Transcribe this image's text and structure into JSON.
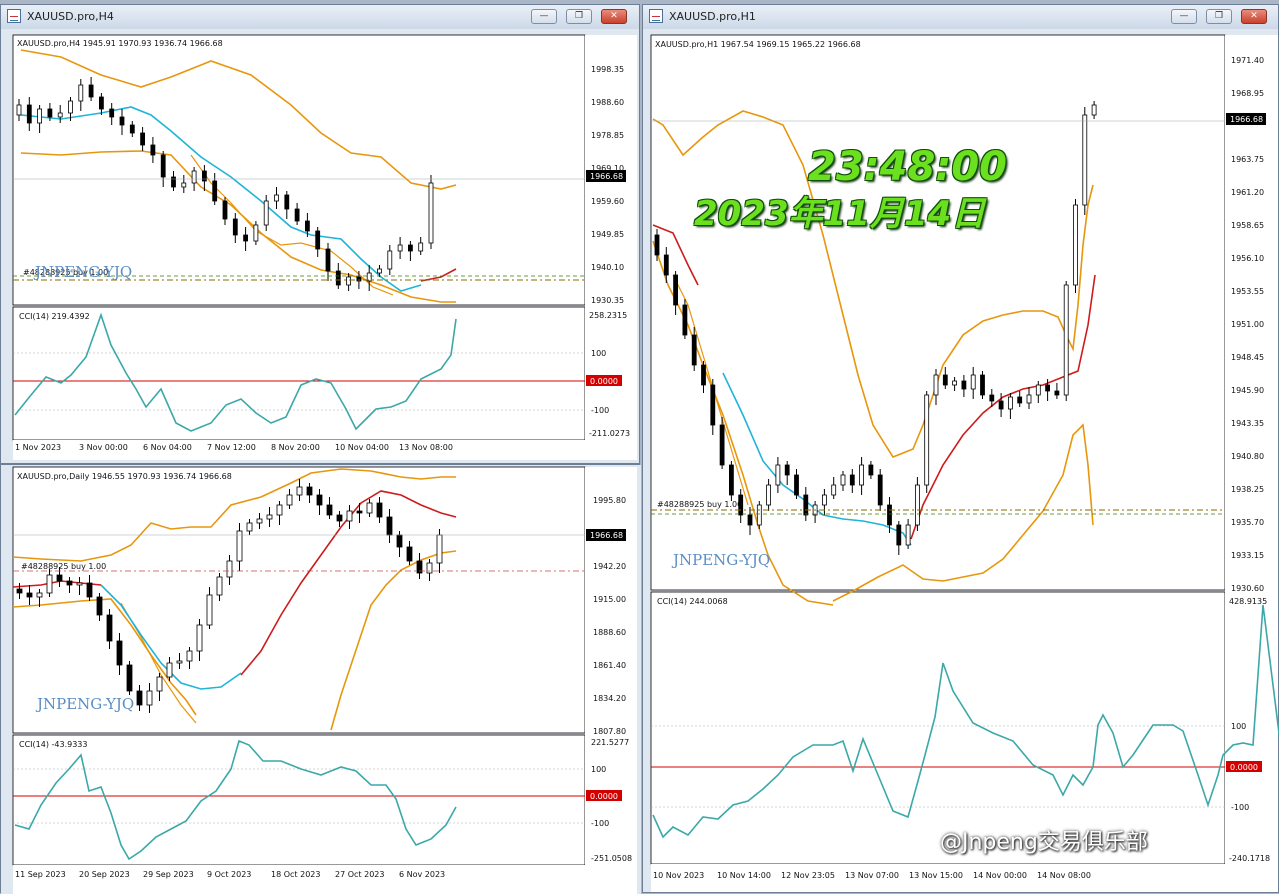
{
  "windows": {
    "h4": {
      "title": "XAUUSD.pro,H4",
      "header": "XAUUSD.pro,H4  1945.91 1970.93 1936.74 1966.68",
      "price_tag": "1966.68",
      "order_label": "#48288925 buy 1.00",
      "watermark": "JNPENG-YJQ",
      "price_scale": [
        "1998.35",
        "1988.60",
        "1978.85",
        "1969.10",
        "1959.60",
        "1949.85",
        "1940.10",
        "1930.35"
      ],
      "cci_header": "CCI(14) 219.4392",
      "cci_scale": [
        "258.2315",
        "100",
        "-100",
        "-211.0273"
      ],
      "cci_zero": "0.0000",
      "time_axis": [
        "1 Nov 2023",
        "3 Nov 00:00",
        "6 Nov 04:00",
        "7 Nov 12:00",
        "8 Nov 20:00",
        "10 Nov 04:00",
        "13 Nov 08:00"
      ]
    },
    "daily": {
      "title": "XAUUSD.pro,Daily",
      "header": "XAUUSD.pro,Daily  1946.55 1970.93 1936.74 1966.68",
      "price_tag": "1966.68",
      "order_label": "#48288925 buy 1.00",
      "watermark": "JNPENG-YJQ",
      "price_scale": [
        "1995.80",
        "1942.20",
        "1915.00",
        "1888.60",
        "1861.40",
        "1834.20",
        "1807.80"
      ],
      "cci_header": "CCI(14) -43.9333",
      "cci_scale": [
        "221.5277",
        "100",
        "-100",
        "-251.0508"
      ],
      "cci_zero": "0.0000",
      "time_axis": [
        "11 Sep 2023",
        "20 Sep 2023",
        "29 Sep 2023",
        "9 Oct 2023",
        "18 Oct 2023",
        "27 Oct 2023",
        "6 Nov 2023"
      ]
    },
    "h1": {
      "title": "XAUUSD.pro,H1",
      "header": "XAUUSD.pro,H1  1967.54 1969.15 1965.22 1966.68",
      "price_tag": "1966.68",
      "order_label": "#48288925 buy 1.00",
      "watermark": "JNPENG-YJQ",
      "price_scale": [
        "1971.40",
        "1968.95",
        "1963.75",
        "1961.20",
        "1958.65",
        "1956.10",
        "1953.55",
        "1951.00",
        "1948.45",
        "1945.90",
        "1943.35",
        "1940.80",
        "1938.25",
        "1935.70",
        "1933.15",
        "1930.60"
      ],
      "cci_header": "CCI(14) 244.0068",
      "cci_scale": [
        "428.9135",
        "100",
        "-100",
        "-240.1718"
      ],
      "cci_zero": "0.0000",
      "time_axis": [
        "10 Nov 2023",
        "10 Nov 14:00",
        "12 Nov 23:05",
        "13 Nov 07:00",
        "13 Nov 15:00",
        "14 Nov 00:00",
        "14 Nov 08:00"
      ]
    }
  },
  "overlay": {
    "time": "23:48:00",
    "date": "2023年11月14日",
    "credit": "@Jnpeng交易俱乐部"
  },
  "colors": {
    "band": "#e8960c",
    "ma_fast": "#1fb4d8",
    "ma_slow": "#cc1c1c",
    "cci": "#3ba8a8",
    "price_tag_bg": "#000000",
    "zero_tag_bg": "#d40000"
  }
}
